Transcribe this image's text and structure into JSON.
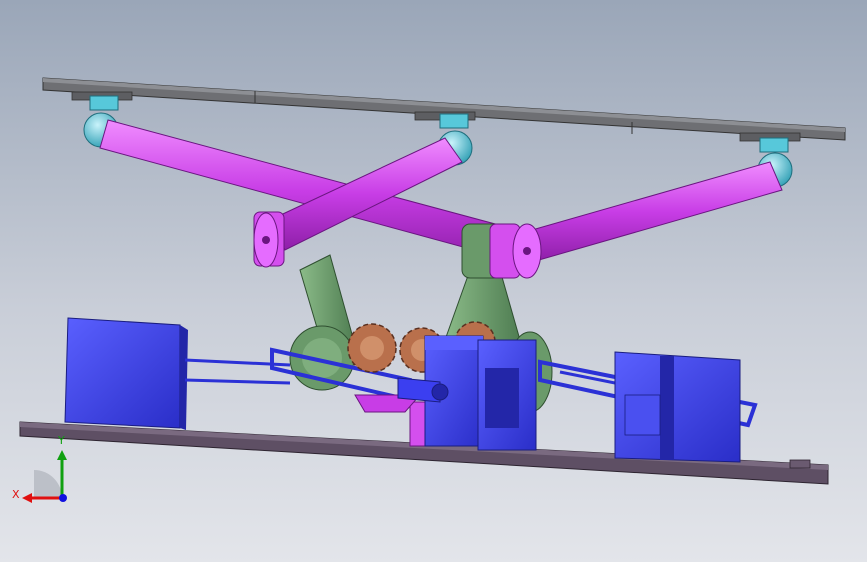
{
  "viewport": {
    "background_top": "#9aa6b8",
    "background_bottom": "#e3e5ea"
  },
  "model": {
    "colors": {
      "plate": "#6e6f73",
      "base_plate": "#5e4f64",
      "rod": "#c83de6",
      "rod_light": "#e56cff",
      "joint": "#6a9a6a",
      "ball": "#51c6d9",
      "motor": "#3b3ff0",
      "gear": "#b9704c",
      "link": "#2b31d6"
    }
  },
  "triad": {
    "x_label": "X",
    "y_label": "Y",
    "x_color": "#e01010",
    "y_color": "#10a010",
    "z_color": "#1010e0"
  }
}
